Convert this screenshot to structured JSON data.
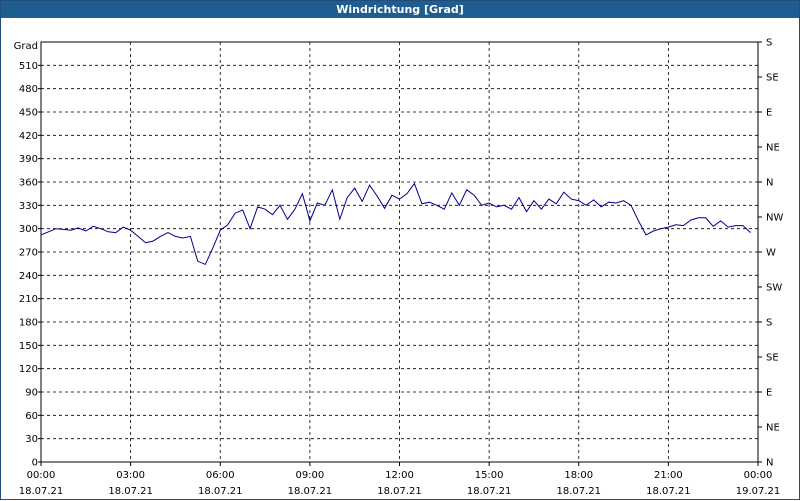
{
  "window": {
    "title": "Windrichtung [Grad]"
  },
  "chart_data": {
    "type": "line",
    "title": "Windrichtung [Grad]",
    "ylabel": "Grad",
    "ylim": [
      0,
      540
    ],
    "xlim": [
      "2021-07-18 00:00",
      "2021-07-19 00:00"
    ],
    "y_ticks": [
      "0",
      "30",
      "60",
      "90",
      "120",
      "150",
      "180",
      "210",
      "240",
      "270",
      "300",
      "330",
      "360",
      "390",
      "420",
      "450",
      "480",
      "510"
    ],
    "right_axis_labels": [
      "N",
      "NE",
      "E",
      "SE",
      "S",
      "SW",
      "W",
      "NW",
      "N",
      "NE",
      "E",
      "SE",
      "S"
    ],
    "x_tick_times": [
      "00:00",
      "03:00",
      "06:00",
      "09:00",
      "12:00",
      "15:00",
      "18:00",
      "21:00",
      "00:00"
    ],
    "x_tick_dates": [
      "18.07.21",
      "18.07.21",
      "18.07.21",
      "18.07.21",
      "18.07.21",
      "18.07.21",
      "18.07.21",
      "18.07.21",
      "19.07.21"
    ],
    "grid": true,
    "series": [
      {
        "color": "#00008b",
        "x_hours": [
          0,
          0.25,
          0.5,
          0.75,
          1,
          1.25,
          1.5,
          1.75,
          2,
          2.25,
          2.5,
          2.75,
          3,
          3.25,
          3.5,
          3.75,
          4,
          4.25,
          4.5,
          4.75,
          5,
          5.25,
          5.5,
          5.75,
          6,
          6.25,
          6.5,
          6.75,
          7,
          7.25,
          7.5,
          7.75,
          8,
          8.25,
          8.5,
          8.75,
          9,
          9.25,
          9.5,
          9.75,
          10,
          10.25,
          10.5,
          10.75,
          11,
          11.25,
          11.5,
          11.75,
          12,
          12.25,
          12.5,
          12.75,
          13,
          13.25,
          13.5,
          13.75,
          14,
          14.25,
          14.5,
          14.75,
          15,
          15.25,
          15.5,
          15.75,
          16,
          16.25,
          16.5,
          16.75,
          17,
          17.25,
          17.5,
          17.75,
          18,
          18.25,
          18.5,
          18.75,
          19,
          19.25,
          19.5,
          19.75,
          20,
          20.25,
          20.5,
          20.75,
          21,
          21.25,
          21.5,
          21.75,
          22,
          22.25,
          22.5,
          22.75,
          23,
          23.25,
          23.5,
          23.75,
          24
        ],
        "values": [
          292,
          296,
          300,
          299,
          298,
          301,
          297,
          303,
          300,
          296,
          295,
          302,
          298,
          290,
          282,
          284,
          290,
          295,
          290,
          288,
          290,
          258,
          254,
          275,
          298,
          305,
          320,
          324,
          300,
          328,
          325,
          318,
          330,
          312,
          325,
          345,
          310,
          333,
          330,
          350,
          312,
          340,
          352,
          335,
          356,
          342,
          326,
          343,
          338,
          345,
          358,
          332,
          334,
          330,
          325,
          346,
          330,
          350,
          343,
          330,
          333,
          328,
          330,
          325,
          340,
          322,
          336,
          325,
          338,
          332,
          347,
          338,
          336,
          330,
          337,
          328,
          334,
          333,
          336,
          330,
          310,
          292,
          297,
          300,
          302,
          305,
          304,
          311,
          314,
          314,
          303,
          310,
          302,
          304,
          304,
          295
        ]
      }
    ]
  }
}
